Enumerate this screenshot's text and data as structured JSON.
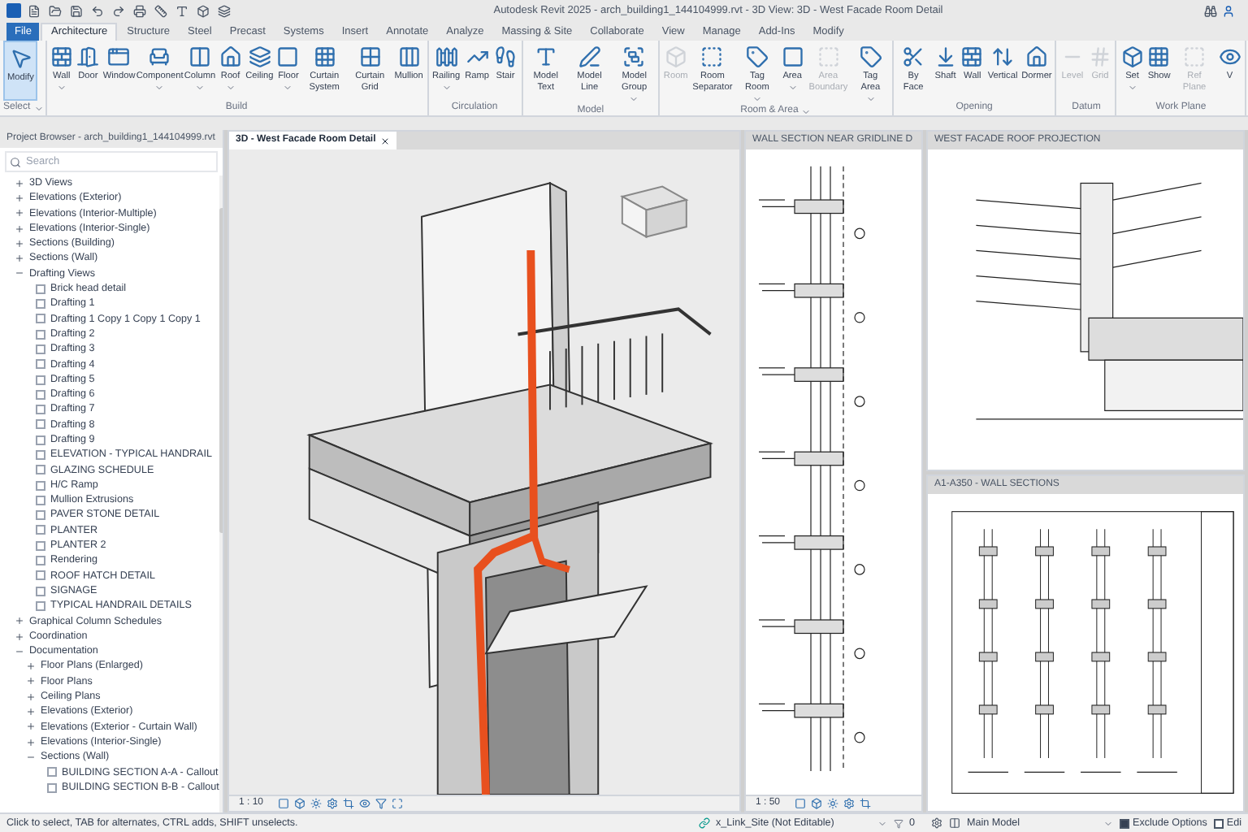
{
  "window": {
    "title": "Autodesk Revit 2025 - arch_building1_144104999.rvt - 3D View: 3D - West Facade Room Detail"
  },
  "ribbon_tabs": [
    {
      "label": "File",
      "kind": "file",
      "selected": false
    },
    {
      "label": "Architecture",
      "kind": "tab",
      "selected": true
    },
    {
      "label": "Structure",
      "kind": "tab",
      "selected": false
    },
    {
      "label": "Steel",
      "kind": "tab",
      "selected": false
    },
    {
      "label": "Precast",
      "kind": "tab",
      "selected": false
    },
    {
      "label": "Systems",
      "kind": "tab",
      "selected": false
    },
    {
      "label": "Insert",
      "kind": "tab",
      "selected": false
    },
    {
      "label": "Annotate",
      "kind": "tab",
      "selected": false
    },
    {
      "label": "Analyze",
      "kind": "tab",
      "selected": false
    },
    {
      "label": "Massing & Site",
      "kind": "tab",
      "selected": false
    },
    {
      "label": "Collaborate",
      "kind": "tab",
      "selected": false
    },
    {
      "label": "View",
      "kind": "tab",
      "selected": false
    },
    {
      "label": "Manage",
      "kind": "tab",
      "selected": false
    },
    {
      "label": "Add-Ins",
      "kind": "tab",
      "selected": false
    },
    {
      "label": "Modify",
      "kind": "tab",
      "selected": false
    }
  ],
  "ribbon_groups": [
    {
      "label": "Select",
      "menu": true,
      "tools": [
        {
          "label": "Modify",
          "selected": true,
          "disabled": false,
          "menu": false
        }
      ]
    },
    {
      "label": "Build",
      "menu": false,
      "tools": [
        {
          "label": "Wall",
          "selected": false,
          "disabled": false,
          "menu": true
        },
        {
          "label": "Door",
          "selected": false,
          "disabled": false,
          "menu": false
        },
        {
          "label": "Window",
          "selected": false,
          "disabled": false,
          "menu": false
        },
        {
          "label": "Component",
          "selected": false,
          "disabled": false,
          "menu": true
        },
        {
          "label": "Column",
          "selected": false,
          "disabled": false,
          "menu": true
        },
        {
          "label": "Roof",
          "selected": false,
          "disabled": false,
          "menu": true
        },
        {
          "label": "Ceiling",
          "selected": false,
          "disabled": false,
          "menu": false
        },
        {
          "label": "Floor",
          "selected": false,
          "disabled": false,
          "menu": true
        },
        {
          "label": "Curtain System",
          "selected": false,
          "disabled": false,
          "menu": false
        },
        {
          "label": "Curtain Grid",
          "selected": false,
          "disabled": false,
          "menu": false
        },
        {
          "label": "Mullion",
          "selected": false,
          "disabled": false,
          "menu": false
        }
      ]
    },
    {
      "label": "Circulation",
      "menu": false,
      "tools": [
        {
          "label": "Railing",
          "selected": false,
          "disabled": false,
          "menu": true
        },
        {
          "label": "Ramp",
          "selected": false,
          "disabled": false,
          "menu": false
        },
        {
          "label": "Stair",
          "selected": false,
          "disabled": false,
          "menu": false
        }
      ]
    },
    {
      "label": "Model",
      "menu": false,
      "tools": [
        {
          "label": "Model Text",
          "selected": false,
          "disabled": false,
          "menu": false
        },
        {
          "label": "Model Line",
          "selected": false,
          "disabled": false,
          "menu": false
        },
        {
          "label": "Model Group",
          "selected": false,
          "disabled": false,
          "menu": true
        }
      ]
    },
    {
      "label": "Room & Area",
      "menu": true,
      "tools": [
        {
          "label": "Room",
          "selected": false,
          "disabled": true,
          "menu": false
        },
        {
          "label": "Room Separator",
          "selected": false,
          "disabled": false,
          "menu": false
        },
        {
          "label": "Tag Room",
          "selected": false,
          "disabled": false,
          "menu": true
        },
        {
          "label": "Area",
          "selected": false,
          "disabled": false,
          "menu": true
        },
        {
          "label": "Area Boundary",
          "selected": false,
          "disabled": true,
          "menu": false
        },
        {
          "label": "Tag Area",
          "selected": false,
          "disabled": false,
          "menu": true
        }
      ]
    },
    {
      "label": "Opening",
      "menu": false,
      "tools": [
        {
          "label": "By Face",
          "selected": false,
          "disabled": false,
          "menu": false
        },
        {
          "label": "Shaft",
          "selected": false,
          "disabled": false,
          "menu": false
        },
        {
          "label": "Wall",
          "selected": false,
          "disabled": false,
          "menu": false
        },
        {
          "label": "Vertical",
          "selected": false,
          "disabled": false,
          "menu": false
        },
        {
          "label": "Dormer",
          "selected": false,
          "disabled": false,
          "menu": false
        }
      ]
    },
    {
      "label": "Datum",
      "menu": false,
      "tools": [
        {
          "label": "Level",
          "selected": false,
          "disabled": true,
          "menu": false
        },
        {
          "label": "Grid",
          "selected": false,
          "disabled": true,
          "menu": false
        }
      ]
    },
    {
      "label": "Work Plane",
      "menu": false,
      "tools": [
        {
          "label": "Set",
          "selected": false,
          "disabled": false,
          "menu": true
        },
        {
          "label": "Show",
          "selected": false,
          "disabled": false,
          "menu": false
        },
        {
          "label": "Ref Plane",
          "selected": false,
          "disabled": true,
          "menu": false
        },
        {
          "label": "V",
          "selected": false,
          "disabled": false,
          "menu": false
        }
      ]
    }
  ],
  "project_browser": {
    "title": "Project Browser - arch_building1_144104999.rvt",
    "search": {
      "placeholder": "Search"
    },
    "tree": [
      {
        "children": [
          {
            "label": "3D Views",
            "expanded": false
          },
          {
            "label": "Elevations (Exterior)",
            "expanded": false
          },
          {
            "label": "Elevations (Interior-Multiple)",
            "expanded": false
          },
          {
            "label": "Elevations (Interior-Single)",
            "expanded": false
          },
          {
            "label": "Sections (Building)",
            "expanded": false
          },
          {
            "label": "Sections (Wall)",
            "expanded": false
          },
          {
            "label": "Drafting Views",
            "expanded": true,
            "children": [
              {
                "label": "Brick head detail"
              },
              {
                "label": "Drafting 1"
              },
              {
                "label": "Drafting 1 Copy 1 Copy 1 Copy 1"
              },
              {
                "label": "Drafting 2"
              },
              {
                "label": "Drafting 3"
              },
              {
                "label": "Drafting 4"
              },
              {
                "label": "Drafting 5"
              },
              {
                "label": "Drafting 6"
              },
              {
                "label": "Drafting 7"
              },
              {
                "label": "Drafting 8"
              },
              {
                "label": "Drafting 9"
              },
              {
                "label": "ELEVATION - TYPICAL HANDRAIL"
              },
              {
                "label": "GLAZING SCHEDULE"
              },
              {
                "label": "H/C Ramp"
              },
              {
                "label": "Mullion Extrusions"
              },
              {
                "label": "PAVER STONE DETAIL"
              },
              {
                "label": "PLANTER"
              },
              {
                "label": "PLANTER 2"
              },
              {
                "label": "Rendering"
              },
              {
                "label": "ROOF HATCH DETAIL"
              },
              {
                "label": "SIGNAGE"
              },
              {
                "label": "TYPICAL HANDRAIL DETAILS"
              }
            ]
          },
          {
            "label": "Graphical Column Schedules",
            "expanded": false
          }
        ]
      },
      {
        "label": "Coordination",
        "expanded": false
      },
      {
        "label": "Documentation",
        "expanded": true,
        "children": [
          {
            "label": "Floor Plans (Enlarged)",
            "expanded": false
          },
          {
            "label": "Floor Plans",
            "expanded": false
          },
          {
            "label": "Ceiling Plans",
            "expanded": false
          },
          {
            "label": "Elevations (Exterior)",
            "expanded": false
          },
          {
            "label": "Elevations (Exterior - Curtain Wall)",
            "expanded": false
          },
          {
            "label": "Elevations (Interior-Single)",
            "expanded": false
          },
          {
            "label": "Sections (Wall)",
            "expanded": true,
            "children": [
              {
                "label": "BUILDING SECTION A-A - Callout"
              },
              {
                "label": "BUILDING SECTION B-B - Callout"
              }
            ]
          }
        ]
      }
    ]
  },
  "views": [
    {
      "title": "3D - West Facade Room Detail",
      "selected": true,
      "kind": "model3d",
      "scale": "1 : 10"
    },
    {
      "title": "WALL SECTION NEAR GRIDLINE D",
      "selected": false,
      "kind": "section",
      "scale": "1 : 50"
    },
    {
      "title": "WEST FACADE ROOF PROJECTION",
      "selected": false,
      "kind": "detail"
    },
    {
      "title": "A1-A350 - WALL SECTIONS",
      "selected": false,
      "kind": "sheet"
    }
  ],
  "status_bar": {
    "message": "Click to select, TAB for alternates, CTRL adds, SHIFT unselects.",
    "workset": "x_Link_Site (Not Editable)",
    "count": "0",
    "design_option": "Main Model",
    "options": [
      {
        "label": "Exclude Options",
        "checked": true
      },
      {
        "label": "Edi",
        "checked": false
      }
    ]
  }
}
